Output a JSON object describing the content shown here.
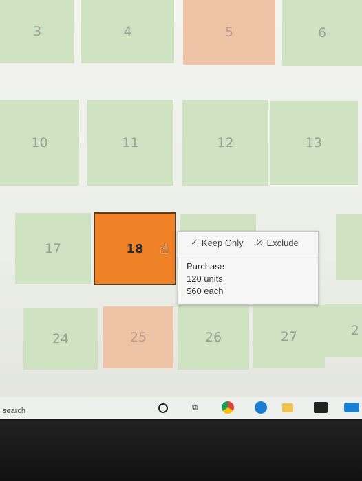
{
  "calendar": {
    "days": [
      "3",
      "4",
      "5",
      "6",
      "10",
      "11",
      "12",
      "13",
      "17",
      "18",
      "24",
      "25",
      "26",
      "27",
      "2"
    ]
  },
  "popup": {
    "keep_only_label": "Keep Only",
    "exclude_label": "Exclude",
    "lines": [
      "Purchase",
      "120 units",
      "$60 each"
    ]
  },
  "taskbar": {
    "search_label": "search"
  },
  "colors": {
    "available": "#cfe3c2",
    "booked": "#efc3a6",
    "selected": "#ef8127"
  }
}
